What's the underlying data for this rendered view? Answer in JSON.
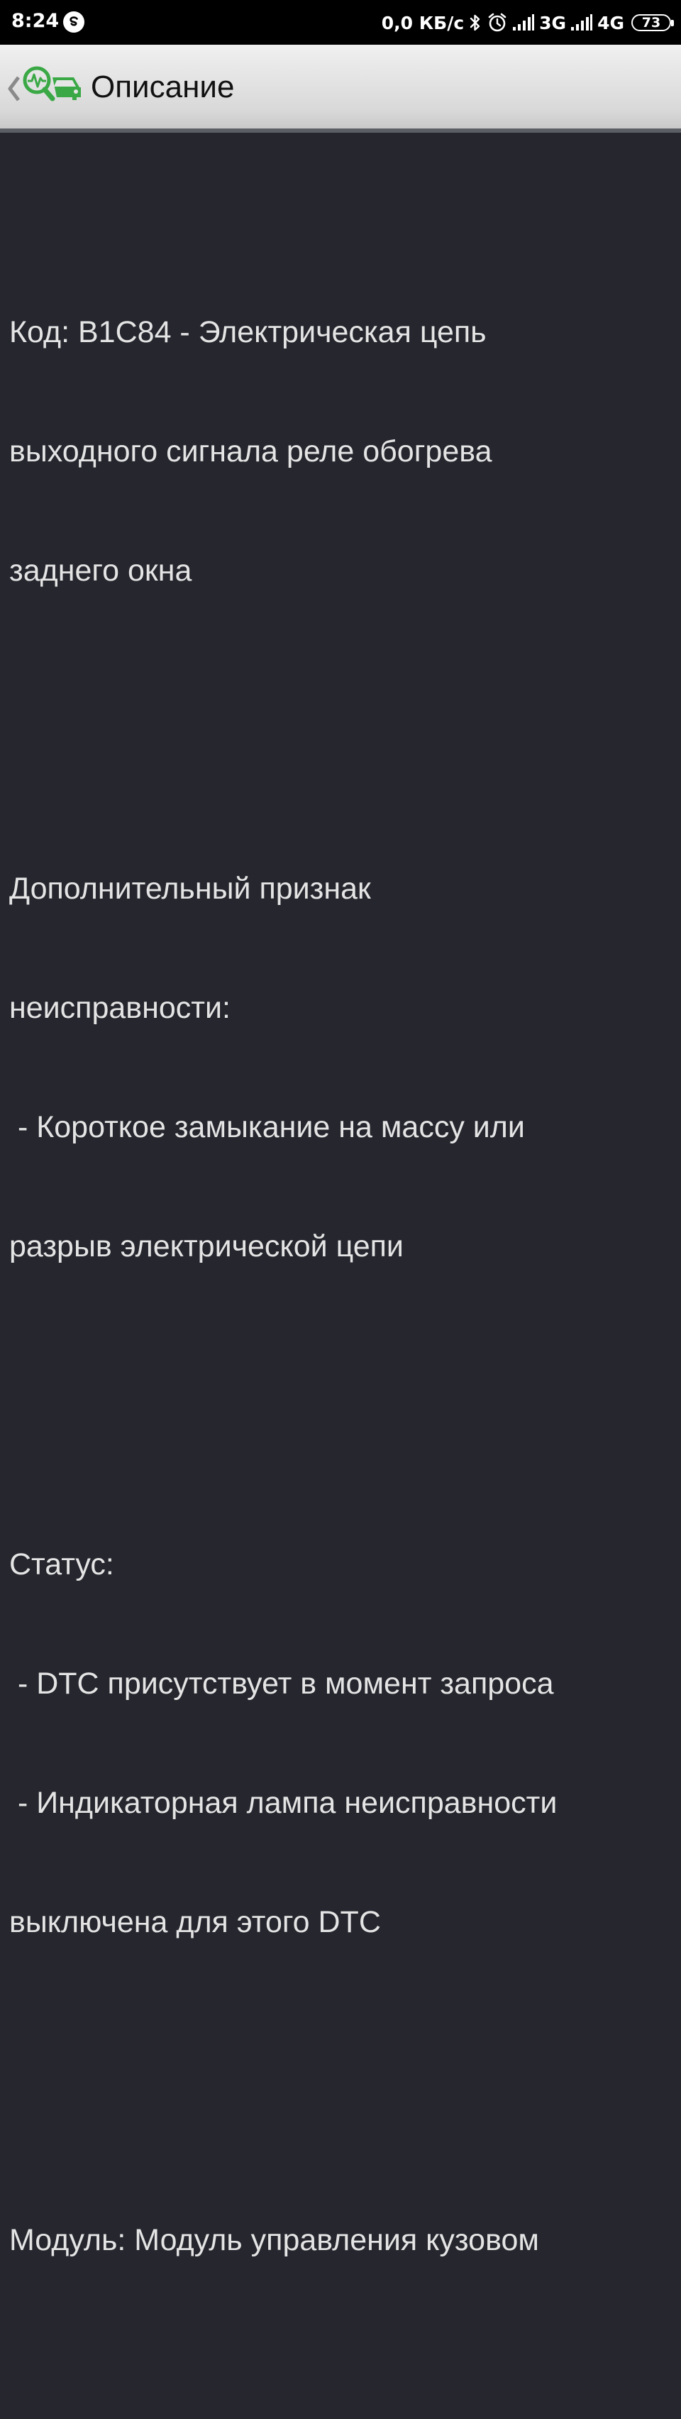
{
  "status_bar": {
    "time": "8:24",
    "speed": "0,0 КБ/с",
    "network_1": "3G",
    "network_2": "4G",
    "battery": "73",
    "icons": [
      "skype-icon",
      "bluetooth-icon",
      "alarm-icon",
      "signal-icon",
      "signal-icon",
      "battery-icon"
    ]
  },
  "app_bar": {
    "title": "Описание",
    "logo": "car-diagnostics-logo"
  },
  "description": {
    "code_line_1": "Код: B1C84 - Электрическая цепь",
    "code_line_2": "выходного сигнала реле обогрева",
    "code_line_3": "заднего окна",
    "extra_line_1": "Дополнительный признак",
    "extra_line_2": "неисправности:",
    "extra_line_3": " - Короткое замыкание на массу или",
    "extra_line_4": "разрыв электрической цепи",
    "status_line_1": "Статус:",
    "status_line_2": " - DTC присутствует в момент запроса",
    "status_line_3": " - Индикаторная лампа неисправности",
    "status_line_4": "выключена для этого DTC",
    "module_line": "Модуль: Модуль управления кузовом"
  },
  "colors": {
    "background": "#25262e",
    "text": "#e4e4e4",
    "accent_green": "#3aa845"
  }
}
